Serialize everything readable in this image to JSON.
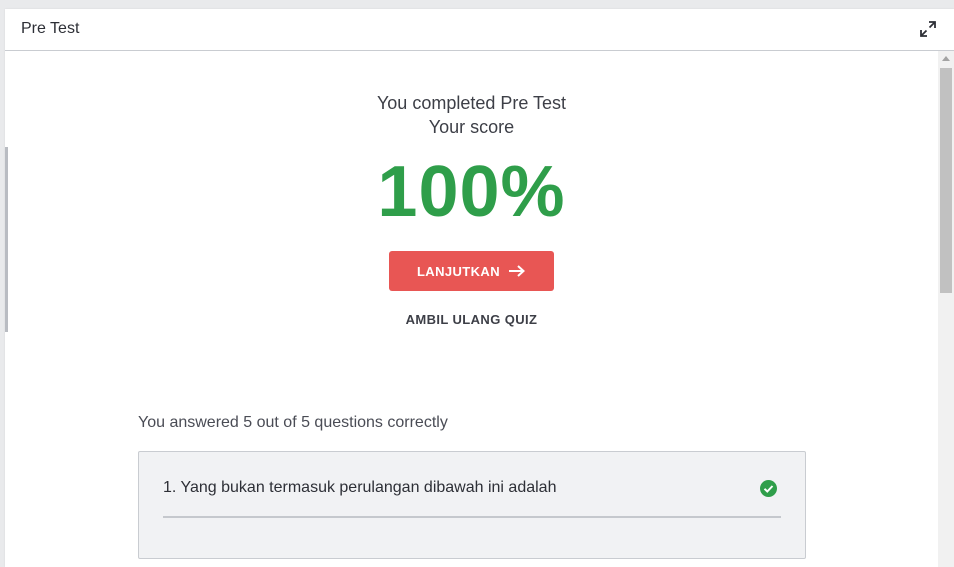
{
  "header": {
    "title": "Pre Test",
    "expand_icon": "expand-icon"
  },
  "result": {
    "completed_text": "You completed Pre Test",
    "score_label": "Your score",
    "score_value": "100%",
    "score_color": "#2f9e4a"
  },
  "actions": {
    "continue_label": "LANJUTKAN",
    "continue_icon": "arrow-right-icon",
    "continue_color": "#e85654",
    "retake_label": "AMBIL ULANG QUIZ"
  },
  "summary": {
    "text": "You answered 5 out of 5 questions correctly"
  },
  "questions": [
    {
      "text": "1. Yang bukan termasuk perulangan dibawah ini adalah",
      "status_icon": "check-circle-icon",
      "correct": true
    }
  ]
}
